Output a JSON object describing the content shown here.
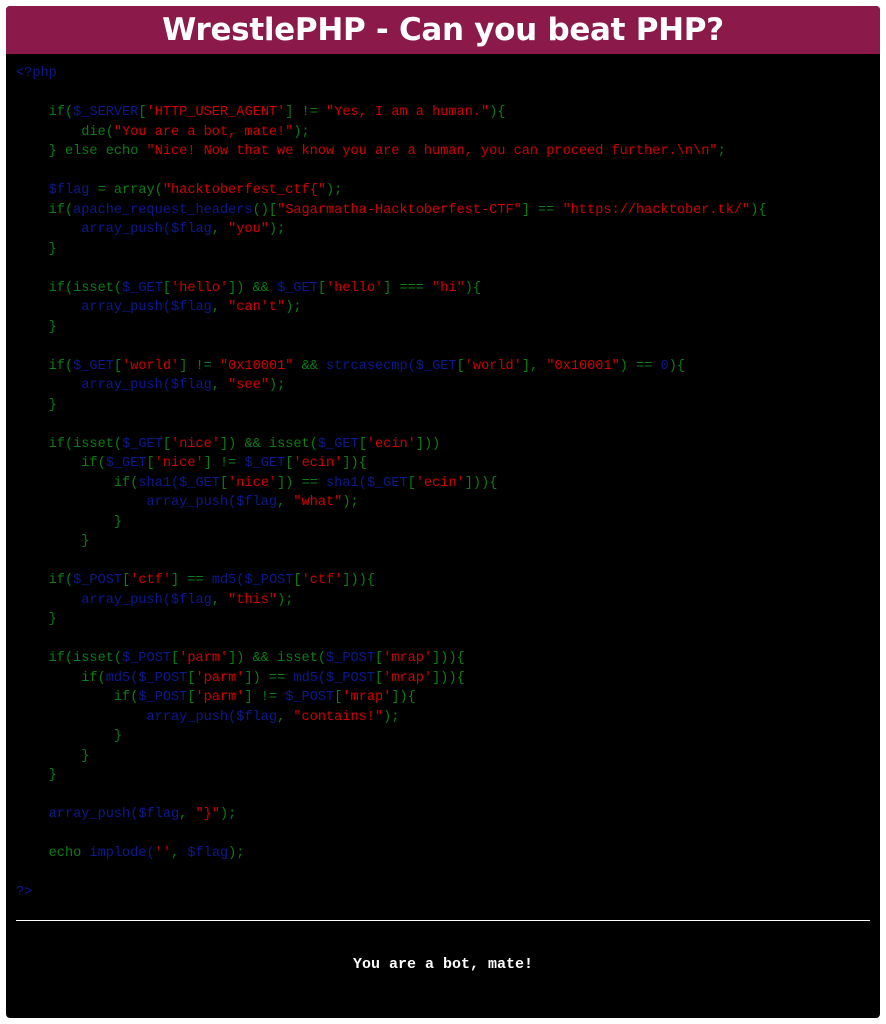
{
  "header": {
    "title": "WrestlePHP - Can you beat PHP?"
  },
  "colors": {
    "title_bar": "#8b1a4b",
    "background": "#000000",
    "default_code": "#0a7d16",
    "string": "#d10000",
    "variable": "#0b1a8f"
  },
  "source_code": {
    "lines": [
      [
        {
          "t": "<?php",
          "c": "var"
        }
      ],
      [],
      [
        {
          "t": "    if(",
          "c": "def"
        },
        {
          "t": "$_SERVER",
          "c": "var"
        },
        {
          "t": "[",
          "c": "def"
        },
        {
          "t": "'HTTP_USER_AGENT'",
          "c": "str"
        },
        {
          "t": "] != ",
          "c": "def"
        },
        {
          "t": "\"Yes, I am a human.\"",
          "c": "str"
        },
        {
          "t": "){",
          "c": "def"
        }
      ],
      [
        {
          "t": "        die(",
          "c": "def"
        },
        {
          "t": "\"You are a bot, mate!\"",
          "c": "str"
        },
        {
          "t": ");",
          "c": "def"
        }
      ],
      [
        {
          "t": "    } else echo ",
          "c": "def"
        },
        {
          "t": "\"Nice! Now that we know you are a human, you can proceed further.\\n\\n\"",
          "c": "str"
        },
        {
          "t": ";",
          "c": "def"
        }
      ],
      [],
      [
        {
          "t": "    $flag",
          "c": "var"
        },
        {
          "t": " = array(",
          "c": "def"
        },
        {
          "t": "\"hacktoberfest_ctf{\"",
          "c": "str"
        },
        {
          "t": ");",
          "c": "def"
        }
      ],
      [
        {
          "t": "    if(",
          "c": "def"
        },
        {
          "t": "apache_request_headers",
          "c": "var"
        },
        {
          "t": "()[",
          "c": "def"
        },
        {
          "t": "\"Sagarmatha-Hacktoberfest-CTF\"",
          "c": "str"
        },
        {
          "t": "] == ",
          "c": "def"
        },
        {
          "t": "\"https://hacktober.tk/\"",
          "c": "str"
        },
        {
          "t": "){",
          "c": "def"
        }
      ],
      [
        {
          "t": "        array_push(",
          "c": "var"
        },
        {
          "t": "$flag",
          "c": "var"
        },
        {
          "t": ", ",
          "c": "def"
        },
        {
          "t": "\"you\"",
          "c": "str"
        },
        {
          "t": ");",
          "c": "def"
        }
      ],
      [
        {
          "t": "    }",
          "c": "def"
        }
      ],
      [],
      [
        {
          "t": "    if(isset(",
          "c": "def"
        },
        {
          "t": "$_GET",
          "c": "var"
        },
        {
          "t": "[",
          "c": "def"
        },
        {
          "t": "'hello'",
          "c": "str"
        },
        {
          "t": "]) && ",
          "c": "def"
        },
        {
          "t": "$_GET",
          "c": "var"
        },
        {
          "t": "[",
          "c": "def"
        },
        {
          "t": "'hello'",
          "c": "str"
        },
        {
          "t": "] === ",
          "c": "def"
        },
        {
          "t": "\"hi\"",
          "c": "str"
        },
        {
          "t": "){",
          "c": "def"
        }
      ],
      [
        {
          "t": "        array_push(",
          "c": "var"
        },
        {
          "t": "$flag",
          "c": "var"
        },
        {
          "t": ", ",
          "c": "def"
        },
        {
          "t": "\"can't\"",
          "c": "str"
        },
        {
          "t": ");",
          "c": "def"
        }
      ],
      [
        {
          "t": "    }",
          "c": "def"
        }
      ],
      [],
      [
        {
          "t": "    if(",
          "c": "def"
        },
        {
          "t": "$_GET",
          "c": "var"
        },
        {
          "t": "[",
          "c": "def"
        },
        {
          "t": "'world'",
          "c": "str"
        },
        {
          "t": "] != ",
          "c": "def"
        },
        {
          "t": "\"0x10001\"",
          "c": "str"
        },
        {
          "t": " && ",
          "c": "def"
        },
        {
          "t": "strcasecmp(",
          "c": "var"
        },
        {
          "t": "$_GET",
          "c": "var"
        },
        {
          "t": "[",
          "c": "def"
        },
        {
          "t": "'world'",
          "c": "str"
        },
        {
          "t": "], ",
          "c": "def"
        },
        {
          "t": "\"0x10001\"",
          "c": "str"
        },
        {
          "t": ") == ",
          "c": "def"
        },
        {
          "t": "0",
          "c": "var"
        },
        {
          "t": "){",
          "c": "def"
        }
      ],
      [
        {
          "t": "        array_push(",
          "c": "var"
        },
        {
          "t": "$flag",
          "c": "var"
        },
        {
          "t": ", ",
          "c": "def"
        },
        {
          "t": "\"see\"",
          "c": "str"
        },
        {
          "t": ");",
          "c": "def"
        }
      ],
      [
        {
          "t": "    }",
          "c": "def"
        }
      ],
      [],
      [
        {
          "t": "    if(isset(",
          "c": "def"
        },
        {
          "t": "$_GET",
          "c": "var"
        },
        {
          "t": "[",
          "c": "def"
        },
        {
          "t": "'nice'",
          "c": "str"
        },
        {
          "t": "]) && isset(",
          "c": "def"
        },
        {
          "t": "$_GET",
          "c": "var"
        },
        {
          "t": "[",
          "c": "def"
        },
        {
          "t": "'ecin'",
          "c": "str"
        },
        {
          "t": "]))",
          "c": "def"
        }
      ],
      [
        {
          "t": "        if(",
          "c": "def"
        },
        {
          "t": "$_GET",
          "c": "var"
        },
        {
          "t": "[",
          "c": "def"
        },
        {
          "t": "'nice'",
          "c": "str"
        },
        {
          "t": "] != ",
          "c": "def"
        },
        {
          "t": "$_GET",
          "c": "var"
        },
        {
          "t": "[",
          "c": "def"
        },
        {
          "t": "'ecin'",
          "c": "str"
        },
        {
          "t": "]){",
          "c": "def"
        }
      ],
      [
        {
          "t": "            if(",
          "c": "def"
        },
        {
          "t": "sha1(",
          "c": "var"
        },
        {
          "t": "$_GET",
          "c": "var"
        },
        {
          "t": "[",
          "c": "def"
        },
        {
          "t": "'nice'",
          "c": "str"
        },
        {
          "t": "]) == ",
          "c": "def"
        },
        {
          "t": "sha1(",
          "c": "var"
        },
        {
          "t": "$_GET",
          "c": "var"
        },
        {
          "t": "[",
          "c": "def"
        },
        {
          "t": "'ecin'",
          "c": "str"
        },
        {
          "t": "])){",
          "c": "def"
        }
      ],
      [
        {
          "t": "                array_push(",
          "c": "var"
        },
        {
          "t": "$flag",
          "c": "var"
        },
        {
          "t": ", ",
          "c": "def"
        },
        {
          "t": "\"what\"",
          "c": "str"
        },
        {
          "t": ");",
          "c": "def"
        }
      ],
      [
        {
          "t": "            }",
          "c": "def"
        }
      ],
      [
        {
          "t": "        }",
          "c": "def"
        }
      ],
      [],
      [
        {
          "t": "    if(",
          "c": "def"
        },
        {
          "t": "$_POST",
          "c": "var"
        },
        {
          "t": "[",
          "c": "def"
        },
        {
          "t": "'ctf'",
          "c": "str"
        },
        {
          "t": "] == ",
          "c": "def"
        },
        {
          "t": "md5(",
          "c": "var"
        },
        {
          "t": "$_POST",
          "c": "var"
        },
        {
          "t": "[",
          "c": "def"
        },
        {
          "t": "'ctf'",
          "c": "str"
        },
        {
          "t": "])){",
          "c": "def"
        }
      ],
      [
        {
          "t": "        array_push(",
          "c": "var"
        },
        {
          "t": "$flag",
          "c": "var"
        },
        {
          "t": ", ",
          "c": "def"
        },
        {
          "t": "\"this\"",
          "c": "str"
        },
        {
          "t": ");",
          "c": "def"
        }
      ],
      [
        {
          "t": "    }",
          "c": "def"
        }
      ],
      [],
      [
        {
          "t": "    if(isset(",
          "c": "def"
        },
        {
          "t": "$_POST",
          "c": "var"
        },
        {
          "t": "[",
          "c": "def"
        },
        {
          "t": "'parm'",
          "c": "str"
        },
        {
          "t": "]) && isset(",
          "c": "def"
        },
        {
          "t": "$_POST",
          "c": "var"
        },
        {
          "t": "[",
          "c": "def"
        },
        {
          "t": "'mrap'",
          "c": "str"
        },
        {
          "t": "])){",
          "c": "def"
        }
      ],
      [
        {
          "t": "        if(",
          "c": "def"
        },
        {
          "t": "md5(",
          "c": "var"
        },
        {
          "t": "$_POST",
          "c": "var"
        },
        {
          "t": "[",
          "c": "def"
        },
        {
          "t": "'parm'",
          "c": "str"
        },
        {
          "t": "]) == ",
          "c": "def"
        },
        {
          "t": "md5(",
          "c": "var"
        },
        {
          "t": "$_POST",
          "c": "var"
        },
        {
          "t": "[",
          "c": "def"
        },
        {
          "t": "'mrap'",
          "c": "str"
        },
        {
          "t": "])){",
          "c": "def"
        }
      ],
      [
        {
          "t": "            if(",
          "c": "def"
        },
        {
          "t": "$_POST",
          "c": "var"
        },
        {
          "t": "[",
          "c": "def"
        },
        {
          "t": "'parm'",
          "c": "str"
        },
        {
          "t": "] != ",
          "c": "def"
        },
        {
          "t": "$_POST",
          "c": "var"
        },
        {
          "t": "[",
          "c": "def"
        },
        {
          "t": "'mrap'",
          "c": "str"
        },
        {
          "t": "]){",
          "c": "def"
        }
      ],
      [
        {
          "t": "                array_push(",
          "c": "var"
        },
        {
          "t": "$flag",
          "c": "var"
        },
        {
          "t": ", ",
          "c": "def"
        },
        {
          "t": "\"contains!\"",
          "c": "str"
        },
        {
          "t": ");",
          "c": "def"
        }
      ],
      [
        {
          "t": "            }",
          "c": "def"
        }
      ],
      [
        {
          "t": "        }",
          "c": "def"
        }
      ],
      [
        {
          "t": "    }",
          "c": "def"
        }
      ],
      [],
      [
        {
          "t": "    array_push(",
          "c": "var"
        },
        {
          "t": "$flag",
          "c": "var"
        },
        {
          "t": ", ",
          "c": "def"
        },
        {
          "t": "\"}\"",
          "c": "str"
        },
        {
          "t": ");",
          "c": "def"
        }
      ],
      [],
      [
        {
          "t": "    echo ",
          "c": "def"
        },
        {
          "t": "implode(",
          "c": "var"
        },
        {
          "t": "''",
          "c": "str"
        },
        {
          "t": ", ",
          "c": "def"
        },
        {
          "t": "$flag",
          "c": "var"
        },
        {
          "t": ");",
          "c": "def"
        }
      ],
      [],
      [
        {
          "t": "?>",
          "c": "var"
        }
      ]
    ]
  },
  "output": {
    "message": "You are a bot, mate!"
  }
}
